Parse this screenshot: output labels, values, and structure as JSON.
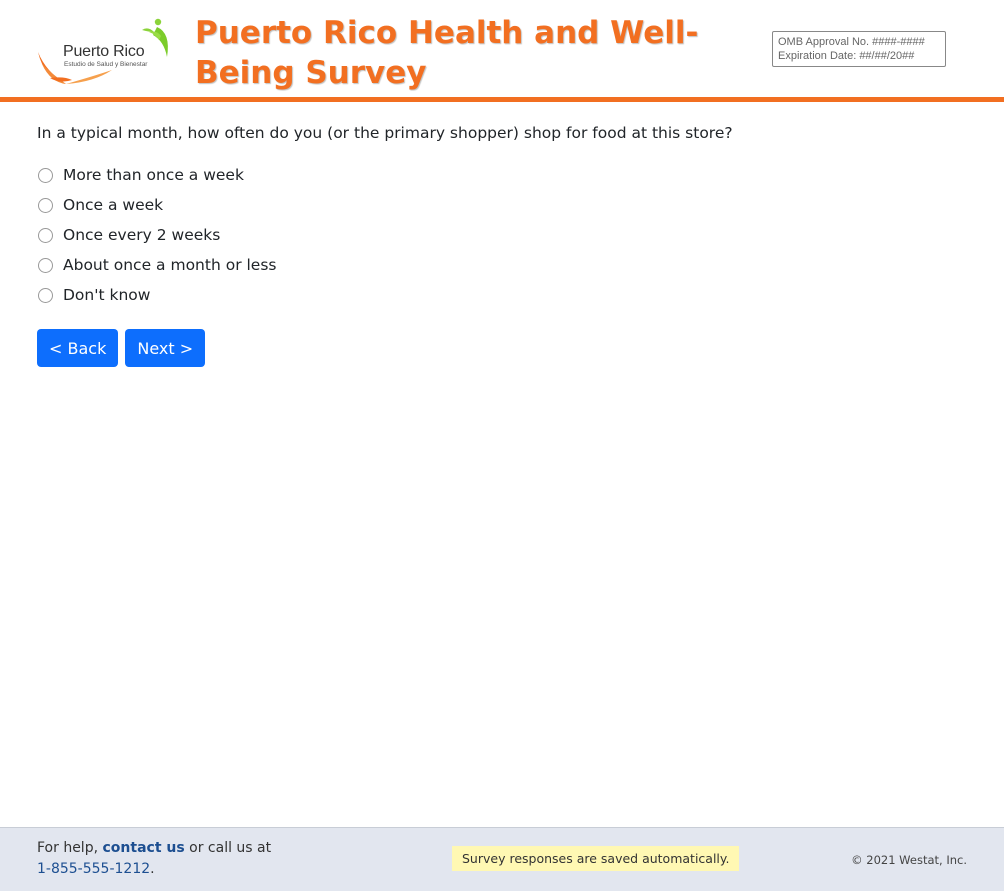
{
  "header": {
    "logo": {
      "name": "Puerto Rico",
      "subtitle": "Estudio de Salud y Bienestar"
    },
    "title": "Puerto Rico Health and Well-Being Survey",
    "omb": {
      "approval": "OMB Approval No. ####-####",
      "expiration": "Expiration Date: ##/##/20##"
    }
  },
  "main": {
    "question": "In a typical month, how often do you (or the primary shopper) shop for food at this store?",
    "options": [
      "More than once a week",
      "Once a week",
      "Once every 2 weeks",
      "About once a month or less",
      "Don't know"
    ],
    "back_label": "< Back",
    "next_label": "Next >"
  },
  "footer": {
    "help_prefix": "For help,",
    "contact_label": "contact us",
    "help_mid": "or call us at",
    "phone": "1-855-555-1212",
    "help_suffix": ".",
    "saved_message": "Survey responses are saved automatically.",
    "copyright": "© 2021 Westat, Inc."
  },
  "colors": {
    "brand_orange": "#f26f21",
    "button_blue": "#0d6efd",
    "link_blue": "#1d4f91",
    "footer_bg": "#e2e6ef",
    "saved_bg": "#fff8b3"
  }
}
